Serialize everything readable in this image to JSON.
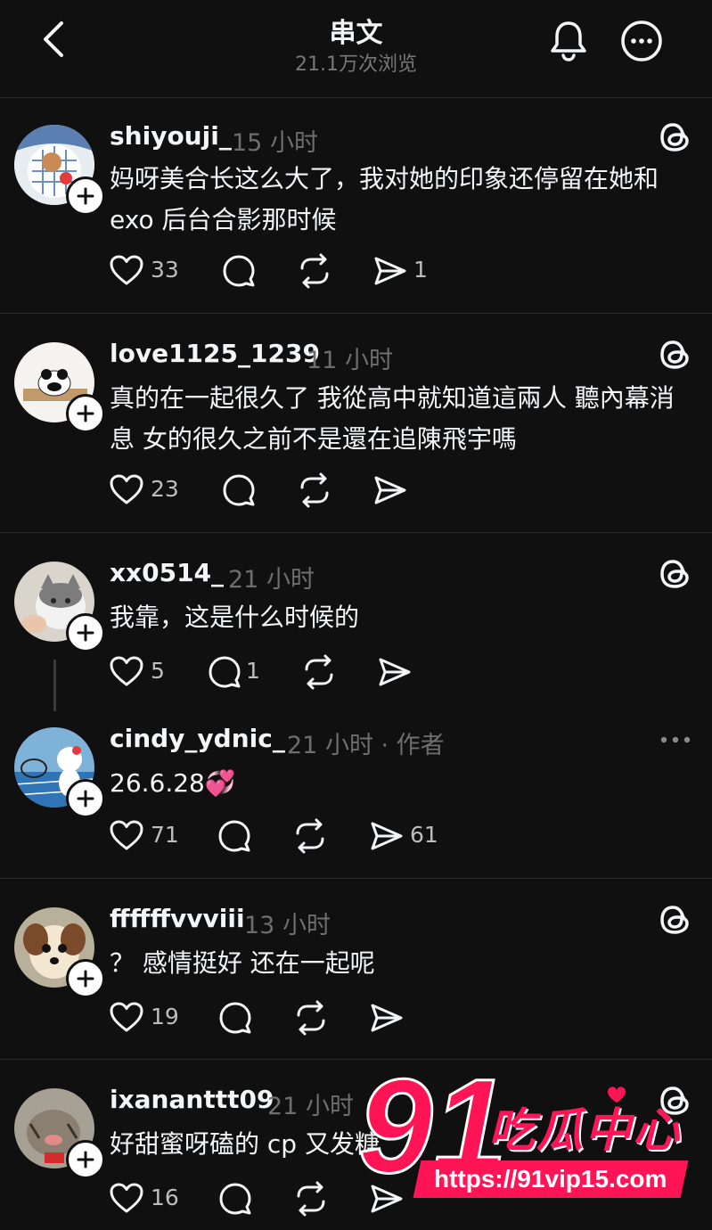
{
  "header": {
    "title": "串文",
    "views": "21.1万次浏览"
  },
  "posts": [
    {
      "username": "shiyouji_",
      "time": "15 小时",
      "text": "妈呀美合长这么大了，我对她的印象还停留在她和 exo 后台合影那时候",
      "likes": "33",
      "replies": "",
      "shares": "1"
    },
    {
      "username": "love1125_1239",
      "time": "11 小时",
      "text": "真的在一起很久了 我從高中就知道這兩人 聽內幕消息 女的很久之前不是還在追陳飛宇嗎",
      "likes": "23",
      "replies": "",
      "shares": ""
    },
    {
      "username": "xx0514_",
      "time": "21 小时",
      "text": "我靠，这是什么时候的",
      "likes": "5",
      "replies": "1",
      "shares": ""
    },
    {
      "username": "cindy_ydnic_",
      "time": "21 小时 · 作者",
      "text": "26.6.28💞",
      "likes": "71",
      "replies": "",
      "shares": "61"
    },
    {
      "username": "ffffffvvviii",
      "time": "13 小时",
      "text": "？ 感情挺好 还在一起呢",
      "likes": "19",
      "replies": "",
      "shares": ""
    },
    {
      "username": "ixananttt09",
      "time": "21 小时",
      "text": "好甜蜜呀磕的 cp 又发糖",
      "likes": "16",
      "replies": "",
      "shares": ""
    }
  ],
  "watermark": {
    "number": "91",
    "name": "吃瓜中心",
    "url": "https://91vip15.com"
  },
  "colors": {
    "background": "#101010",
    "text": "#f3f5f7",
    "muted": "#6e6e6e",
    "watermark": "#ff1456"
  }
}
